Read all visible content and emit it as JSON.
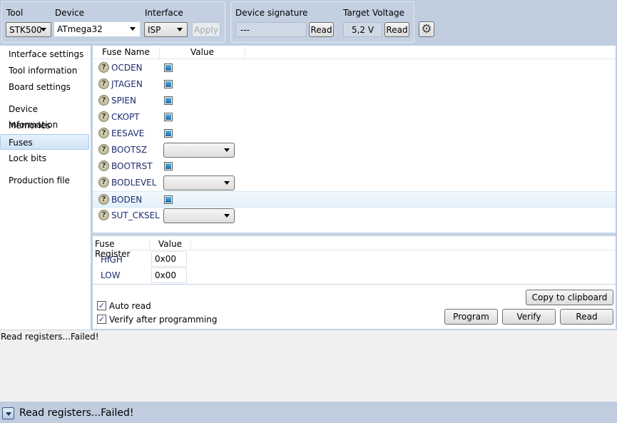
{
  "toolbar": {
    "tool_label": "Tool",
    "tool_value": "STK500",
    "device_label": "Device",
    "device_value": "ATmega32",
    "interface_label": "Interface",
    "interface_value": "ISP",
    "apply": "Apply",
    "signature_label": "Device signature",
    "signature_value": "---",
    "signature_read": "Read",
    "voltage_label": "Target Voltage",
    "voltage_value": "5,2 V",
    "voltage_read": "Read"
  },
  "sidebar": {
    "items": [
      {
        "label": "Interface settings"
      },
      {
        "label": "Tool information"
      },
      {
        "label": "Board settings"
      },
      {
        "label": "Device information"
      },
      {
        "label": "Memories"
      },
      {
        "label": "Fuses"
      },
      {
        "label": "Lock bits"
      },
      {
        "label": "Production file"
      }
    ],
    "selected": "Fuses"
  },
  "fuses": {
    "headers": [
      "Fuse Name",
      "Value"
    ],
    "rows": [
      {
        "name": "OCDEN",
        "type": "check"
      },
      {
        "name": "JTAGEN",
        "type": "check"
      },
      {
        "name": "SPIEN",
        "type": "check"
      },
      {
        "name": "CKOPT",
        "type": "check"
      },
      {
        "name": "EESAVE",
        "type": "check"
      },
      {
        "name": "BOOTSZ",
        "type": "combo"
      },
      {
        "name": "BOOTRST",
        "type": "check"
      },
      {
        "name": "BODLEVEL",
        "type": "combo"
      },
      {
        "name": "BODEN",
        "type": "check"
      },
      {
        "name": "SUT_CKSEL",
        "type": "combo"
      }
    ]
  },
  "registers": {
    "headers": [
      "Fuse Register",
      "Value"
    ],
    "rows": [
      {
        "name": "HIGH",
        "value": "0x00"
      },
      {
        "name": "LOW",
        "value": "0x00"
      }
    ]
  },
  "options": {
    "auto_read": "Auto read",
    "verify_after": "Verify after programming"
  },
  "buttons": {
    "copy": "Copy to clipboard",
    "program": "Program",
    "verify": "Verify",
    "read": "Read"
  },
  "log": {
    "text": "Read registers...Failed!"
  },
  "status": {
    "text": "Read registers...Failed!"
  }
}
